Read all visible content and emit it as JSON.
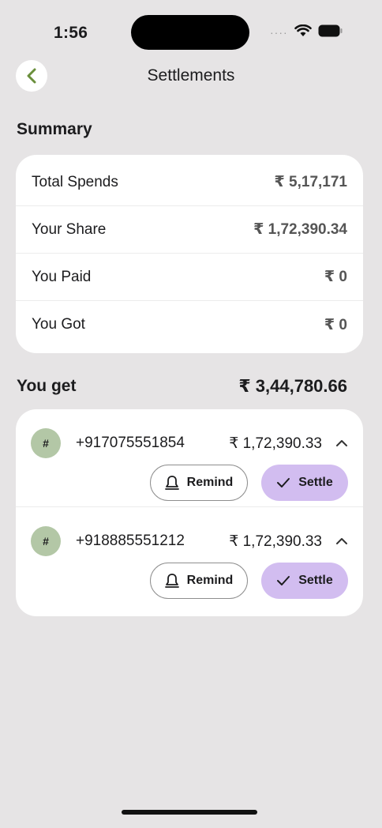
{
  "status_bar": {
    "time": "1:56",
    "dots": "····"
  },
  "nav": {
    "title": "Settlements"
  },
  "summary": {
    "title": "Summary",
    "rows": [
      {
        "label": "Total Spends",
        "value": "₹ 5,17,171"
      },
      {
        "label": "Your Share",
        "value": "₹ 1,72,390.34"
      },
      {
        "label": "You Paid",
        "value": "₹ 0"
      },
      {
        "label": "You Got",
        "value": "₹ 0"
      }
    ]
  },
  "you_get": {
    "label": "You get",
    "total": "₹ 3,44,780.66",
    "people": [
      {
        "avatar": "#",
        "phone": "+917075551854",
        "amount": "₹ 1,72,390.33",
        "remind_label": "Remind",
        "settle_label": "Settle"
      },
      {
        "avatar": "#",
        "phone": "+918885551212",
        "amount": "₹ 1,72,390.33",
        "remind_label": "Remind",
        "settle_label": "Settle"
      }
    ]
  },
  "colors": {
    "background": "#e6e4e5",
    "accent": "#d2bdf0",
    "back_arrow": "#6a8f3c",
    "avatar": "#b3c7a6"
  },
  "icons": [
    "back-arrow-icon",
    "wifi-icon",
    "battery-icon",
    "bell-icon",
    "check-icon",
    "chevron-up-icon"
  ]
}
